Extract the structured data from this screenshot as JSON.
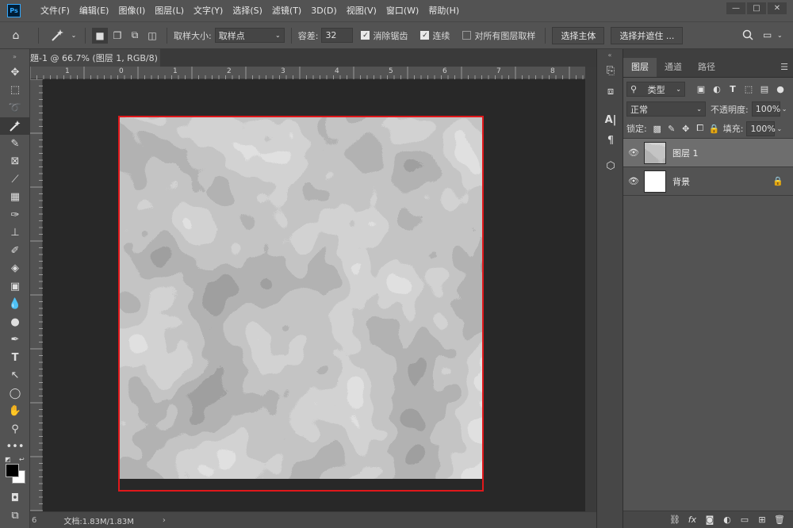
{
  "app": {
    "logo": "Ps"
  },
  "menu": [
    "文件(F)",
    "编辑(E)",
    "图像(I)",
    "图层(L)",
    "文字(Y)",
    "选择(S)",
    "滤镜(T)",
    "3D(D)",
    "视图(V)",
    "窗口(W)",
    "帮助(H)"
  ],
  "window_controls": {
    "minimize": "—",
    "maximize": "□",
    "close": "✕"
  },
  "options": {
    "sample_size_label": "取样大小:",
    "sample_size_value": "取样点",
    "tolerance_label": "容差:",
    "tolerance_value": "32",
    "antialias_label": "消除锯齿",
    "antialias_checked": true,
    "contiguous_label": "连续",
    "contiguous_checked": true,
    "sample_all_label": "对所有图层取样",
    "sample_all_checked": false,
    "select_subject": "选择主体",
    "select_mask": "选择并遮住 ..."
  },
  "document": {
    "tab_title": "題-1 @ 66.7% (图层 1, RGB/8) *",
    "ruler_ticks": [
      "1",
      "0",
      "1",
      "2",
      "3",
      "4",
      "5",
      "6",
      "7",
      "8",
      "9"
    ],
    "status": "文档:1.83M/1.83M"
  },
  "toolbar_icons": [
    "move-icon",
    "marquee-icon",
    "lasso-icon",
    "magic-wand-icon",
    "eyedropper-icon",
    "crop-icon",
    "brush-icon",
    "healing-icon",
    "brush-icon",
    "stamp-icon",
    "history-brush-icon",
    "eraser-icon",
    "gradient-icon",
    "blur-icon",
    "dodge-icon",
    "pen-icon",
    "type-icon",
    "path-select-icon",
    "ellipse-icon",
    "hand-icon",
    "zoom-icon",
    "more-icon"
  ],
  "layers_panel": {
    "tabs": [
      "图层",
      "通道",
      "路径"
    ],
    "filter_kind": "类型",
    "blend_mode": "正常",
    "opacity_label": "不透明度:",
    "opacity_value": "100%",
    "lock_label": "锁定:",
    "fill_label": "填充:",
    "fill_value": "100%",
    "layers": [
      {
        "name": "图层 1",
        "selected": true
      },
      {
        "name": "背景",
        "selected": false,
        "locked": true
      }
    ],
    "footer_icons": [
      "link-icon",
      "fx-icon",
      "mask-icon",
      "adjustment-icon",
      "group-icon",
      "new-layer-icon",
      "trash-icon"
    ]
  },
  "colors": {
    "selection_frame": "#e0181b",
    "panel_bg": "#535353",
    "workspace_bg": "#282828"
  }
}
